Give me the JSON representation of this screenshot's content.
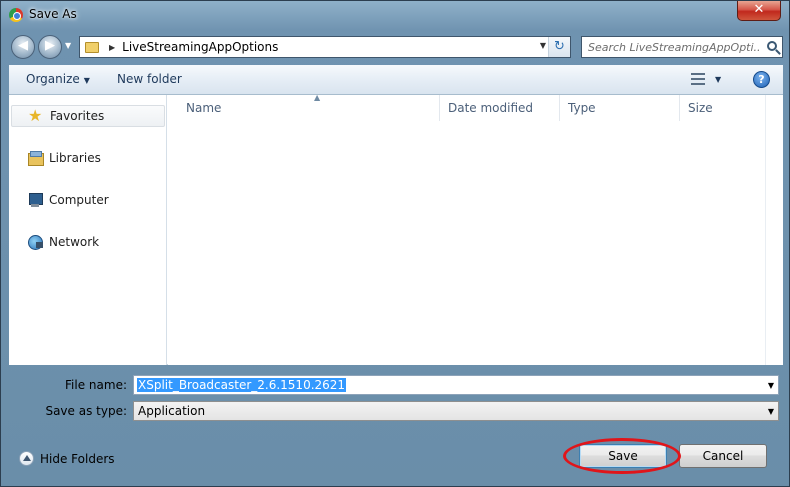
{
  "window": {
    "title": "Save As",
    "close_glyph": "✕"
  },
  "nav": {
    "back_glyph": "◀",
    "forward_glyph": "▶",
    "history_glyph": "▼"
  },
  "address": {
    "path": "LiveStreamingAppOptions",
    "arrow": "▶",
    "dropdown_glyph": "▼",
    "refresh_glyph": "↻"
  },
  "search": {
    "placeholder": "Search LiveStreamingAppOpti..."
  },
  "toolbar": {
    "organize_label": "Organize",
    "organize_caret": "▼",
    "new_folder_label": "New folder",
    "view_caret": "▼",
    "help_glyph": "?"
  },
  "sidebar": {
    "items": [
      {
        "label": "Favorites",
        "icon": "star-icon"
      },
      {
        "label": "Libraries",
        "icon": "libraries-icon"
      },
      {
        "label": "Computer",
        "icon": "computer-icon"
      },
      {
        "label": "Network",
        "icon": "network-icon"
      }
    ]
  },
  "file_list": {
    "columns": [
      "Name",
      "Date modified",
      "Type",
      "Size"
    ],
    "sort_glyph": "▲",
    "rows": []
  },
  "form": {
    "file_name_label": "File name:",
    "file_name_value": "XSplit_Broadcaster_2.6.1510.2621",
    "save_type_label": "Save as type:",
    "save_type_value": "Application",
    "dropdown_glyph": "▼"
  },
  "footer": {
    "hide_folders_label": "Hide Folders",
    "save_label": "Save",
    "cancel_label": "Cancel"
  },
  "colors": {
    "selection": "#3399ff",
    "highlight_ring": "#e0151a",
    "titlebar": "#8fb1c9"
  }
}
